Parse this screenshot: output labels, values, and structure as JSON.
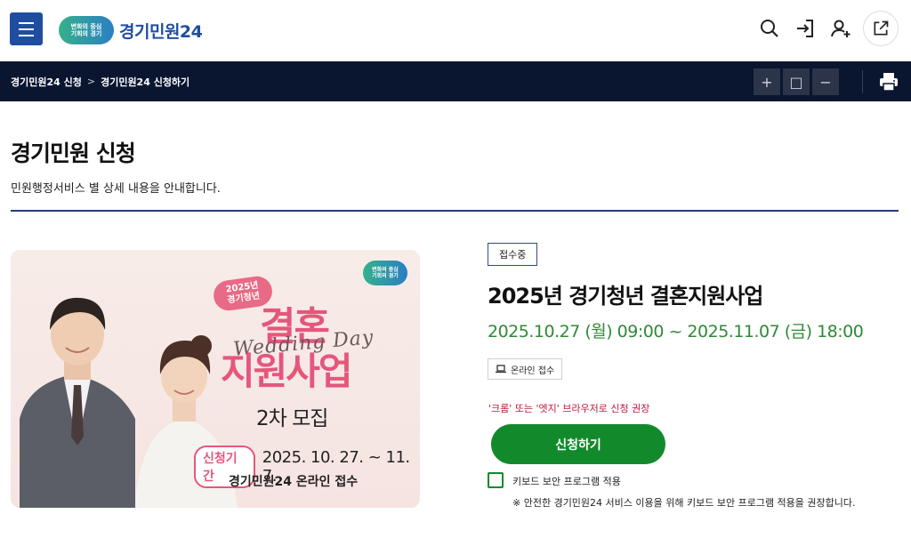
{
  "header": {
    "logo_badge_line1": "변화의 중심",
    "logo_badge_line2": "기회의 경기",
    "logo_text": "경기민원24"
  },
  "navbar": {
    "breadcrumb": [
      "경기민원24 신청",
      "경기민원24 신청하기"
    ],
    "breadcrumb_sep": ">",
    "tools": [
      "+",
      "□",
      "−"
    ]
  },
  "page": {
    "title": "경기민원 신청",
    "description": "민원행정서비스 별 상세 내용을 안내합니다."
  },
  "poster": {
    "badge_line1": "변화의 중심",
    "badge_line2": "기회의 경기",
    "year_line1": "2025년",
    "year_line2": "경기청년",
    "title_line1": "결혼",
    "title_line2": "지원사업",
    "script": "Wedding Day",
    "round": "2차 모집",
    "period_label": "신청기간",
    "period_date": "2025. 10. 27. ~ 11. 7.",
    "footer": "경기민원24 온라인 접수"
  },
  "service": {
    "status": "접수중",
    "title": "2025년 경기청년 결혼지원사업",
    "period": "2025.10.27 (월) 09:00 ~ 2025.11.07 (금) 18:00",
    "channel": "온라인 접수",
    "browser_notice": "'크롬' 또는 '엣지' 브라우저로 신청 권장",
    "apply_label": "신청하기",
    "keyboard_label": "키보드 보안 프로그램 적용",
    "keyboard_note": "※ 안전한 경기민원24 서비스 이용을 위해 키보드 보안 프로그램 적용을 권장합니다."
  },
  "colors": {
    "brand_blue": "#1f4ea1",
    "navbar_bg": "#0a1530",
    "apply_green": "#128a2c",
    "period_green": "#2f8a35",
    "notice_red": "#c2183c",
    "poster_pink": "#e4577b"
  }
}
